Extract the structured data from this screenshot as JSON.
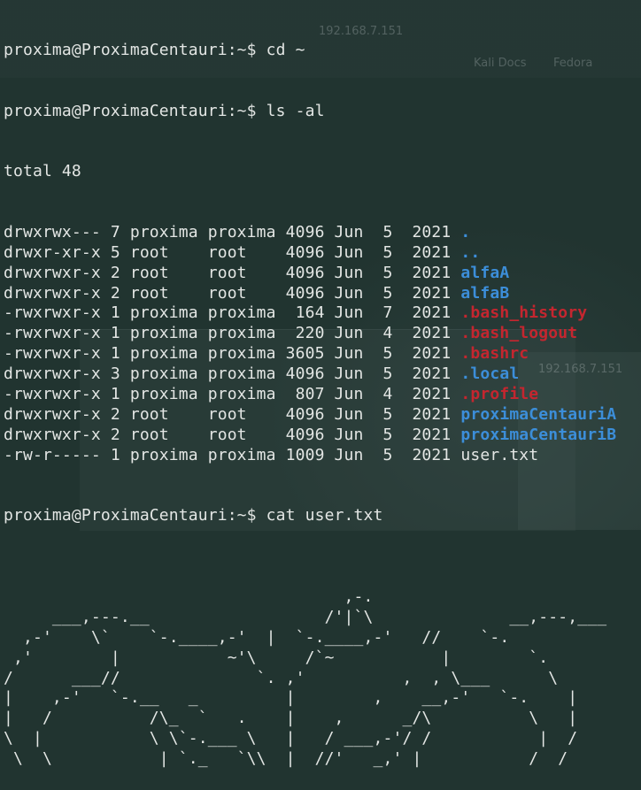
{
  "background_ghost": {
    "address": "192.168.7.151",
    "bookmarks": [
      "Kali Docs",
      "Fedora"
    ],
    "ip_label": "192.168.7.151"
  },
  "terminal": {
    "prompt": "proxima@ProximaCentauri:~$ ",
    "commands": {
      "cd": "cd ~",
      "ls": "ls -al",
      "cat": "cat user.txt"
    },
    "total": "total 48",
    "entries": [
      {
        "meta": "drwxrwx--- 7 proxima proxima 4096 Jun  5  2021 ",
        "name": ".",
        "kind": "dir"
      },
      {
        "meta": "drwxr-xr-x 5 root    root    4096 Jun  5  2021 ",
        "name": "..",
        "kind": "dir"
      },
      {
        "meta": "drwxrwxr-x 2 root    root    4096 Jun  5  2021 ",
        "name": "alfaA",
        "kind": "dir"
      },
      {
        "meta": "drwxrwxr-x 2 root    root    4096 Jun  5  2021 ",
        "name": "alfaB",
        "kind": "dir"
      },
      {
        "meta": "-rwxrwxr-x 1 proxima proxima  164 Jun  7  2021 ",
        "name": ".bash_history",
        "kind": "hid"
      },
      {
        "meta": "-rwxrwxr-x 1 proxima proxima  220 Jun  4  2021 ",
        "name": ".bash_logout",
        "kind": "hid"
      },
      {
        "meta": "-rwxrwxr-x 1 proxima proxima 3605 Jun  5  2021 ",
        "name": ".bashrc",
        "kind": "hid"
      },
      {
        "meta": "drwxrwxr-x 3 proxima proxima 4096 Jun  5  2021 ",
        "name": ".local",
        "kind": "dir"
      },
      {
        "meta": "-rwxrwxr-x 1 proxima proxima  807 Jun  4  2021 ",
        "name": ".profile",
        "kind": "hid"
      },
      {
        "meta": "drwxrwxr-x 2 root    root    4096 Jun  5  2021 ",
        "name": "proximaCentauriA",
        "kind": "dir"
      },
      {
        "meta": "drwxrwxr-x 2 root    root    4096 Jun  5  2021 ",
        "name": "proximaCentauriB",
        "kind": "dir"
      },
      {
        "meta": "-rw-r----- 1 proxima proxima 1009 Jun  5  2021 ",
        "name": "user.txt",
        "kind": "file"
      }
    ],
    "art_lines": [
      "",
      "                                   ,-.",
      "     ___,---.__                  /'|`\\              __,---,___",
      "  ,-'    \\`    `-.____,-'  |  `-.____,-'   //    `-.",
      " ,'        |           ~'\\     /`~           |        `.",
      "/      ___//              `. ,'          ,  , \\___      \\",
      "|    ,-'   `-.__   _         |        ,    __,-'   `-.    |",
      "|   /          /\\_  `   .    |    ,      _/\\          \\   |",
      "\\  |           \\ \\`-.___ \\   |   / ___,-'/ /           |  /",
      " \\  \\           | `._   `\\\\  |  //'   _,' |           /  /"
    ],
    "colors": {
      "text": "#e3e6e4",
      "directory": "#3c8ed9",
      "hidden_file": "#c4262f",
      "background": "#213430"
    }
  }
}
